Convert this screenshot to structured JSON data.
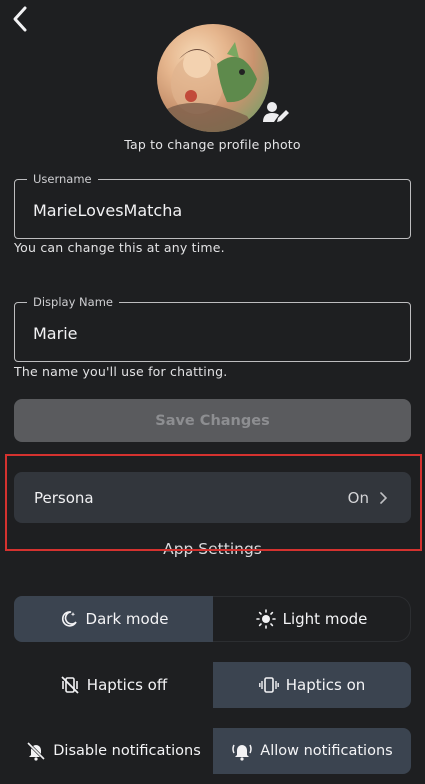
{
  "profile": {
    "photo_caption": "Tap to change profile photo"
  },
  "username": {
    "label": "Username",
    "value": "MarieLovesMatcha",
    "helper": "You can change this at any time."
  },
  "display_name": {
    "label": "Display Name",
    "value": "Marie",
    "helper": "The name you'll use for chatting."
  },
  "save_button": {
    "label": "Save Changes"
  },
  "persona": {
    "label": "Persona",
    "value": "On"
  },
  "app_settings": {
    "title": "App Settings",
    "theme": {
      "dark": "Dark mode",
      "light": "Light mode",
      "selected": "Dark mode"
    },
    "haptics": {
      "off": "Haptics off",
      "on": "Haptics on",
      "selected": "Haptics on"
    },
    "notifications": {
      "disable": "Disable notifications",
      "allow": "Allow notifications",
      "selected": "Allow notifications"
    }
  },
  "colors": {
    "background": "#1e1f21",
    "segment_active": "#3b4450",
    "highlight_border": "#d4322f"
  },
  "icons": [
    "back-chevron-icon",
    "edit-person-icon",
    "chevron-right-icon",
    "moon-icon",
    "sun-icon",
    "vibrate-off-icon",
    "vibrate-icon",
    "bell-off-icon",
    "bell-ring-icon"
  ]
}
